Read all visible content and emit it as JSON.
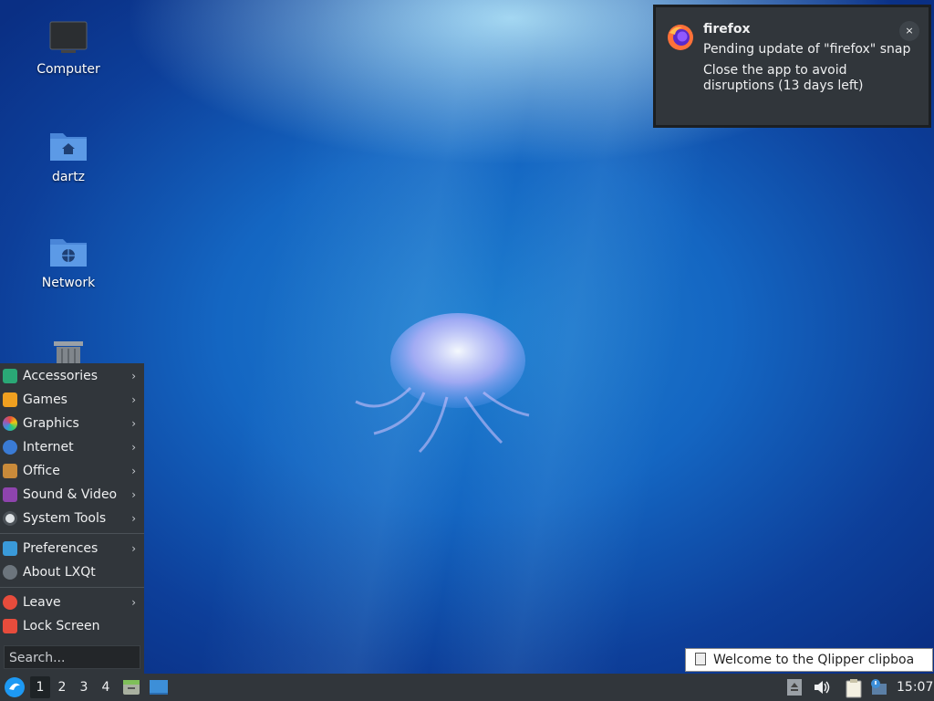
{
  "desktop": {
    "icons": [
      {
        "label": "Computer"
      },
      {
        "label": "dartz"
      },
      {
        "label": "Network"
      }
    ]
  },
  "notification": {
    "app": "firefox",
    "line1": "Pending update of \"firefox\" snap",
    "line2": "Close the app to avoid disruptions (13 days left)",
    "close": "×"
  },
  "menu": {
    "items": [
      {
        "label": "Accessories",
        "icon": "accessories-icon",
        "color": "#2aa876",
        "submenu": true
      },
      {
        "label": "Games",
        "icon": "games-icon",
        "color": "#f0a020",
        "submenu": true
      },
      {
        "label": "Graphics",
        "icon": "graphics-icon",
        "color": "#e04c8c",
        "submenu": true
      },
      {
        "label": "Internet",
        "icon": "internet-icon",
        "color": "#3a7bd5",
        "submenu": true
      },
      {
        "label": "Office",
        "icon": "office-icon",
        "color": "#c98a3a",
        "submenu": true
      },
      {
        "label": "Sound & Video",
        "icon": "sound-video-icon",
        "color": "#8e44ad",
        "submenu": true
      },
      {
        "label": "System Tools",
        "icon": "system-tools-icon",
        "color": "#7f8c8d",
        "submenu": true
      }
    ],
    "items2": [
      {
        "label": "Preferences",
        "icon": "preferences-icon",
        "color": "#3a9ad9",
        "submenu": true
      },
      {
        "label": "About LXQt",
        "icon": "about-icon",
        "color": "#6c757d",
        "submenu": false
      }
    ],
    "items3": [
      {
        "label": "Leave",
        "icon": "leave-icon",
        "color": "#e74c3c",
        "submenu": true
      },
      {
        "label": "Lock Screen",
        "icon": "lock-icon",
        "color": "#e74c3c",
        "submenu": false
      }
    ],
    "chevron": "›",
    "search_placeholder": "Search..."
  },
  "tooltip": {
    "text": "Welcome to the Qlipper clipboa"
  },
  "taskbar": {
    "desktops": [
      "1",
      "2",
      "3",
      "4"
    ],
    "active_desktop": "1",
    "clock": "15:07"
  }
}
